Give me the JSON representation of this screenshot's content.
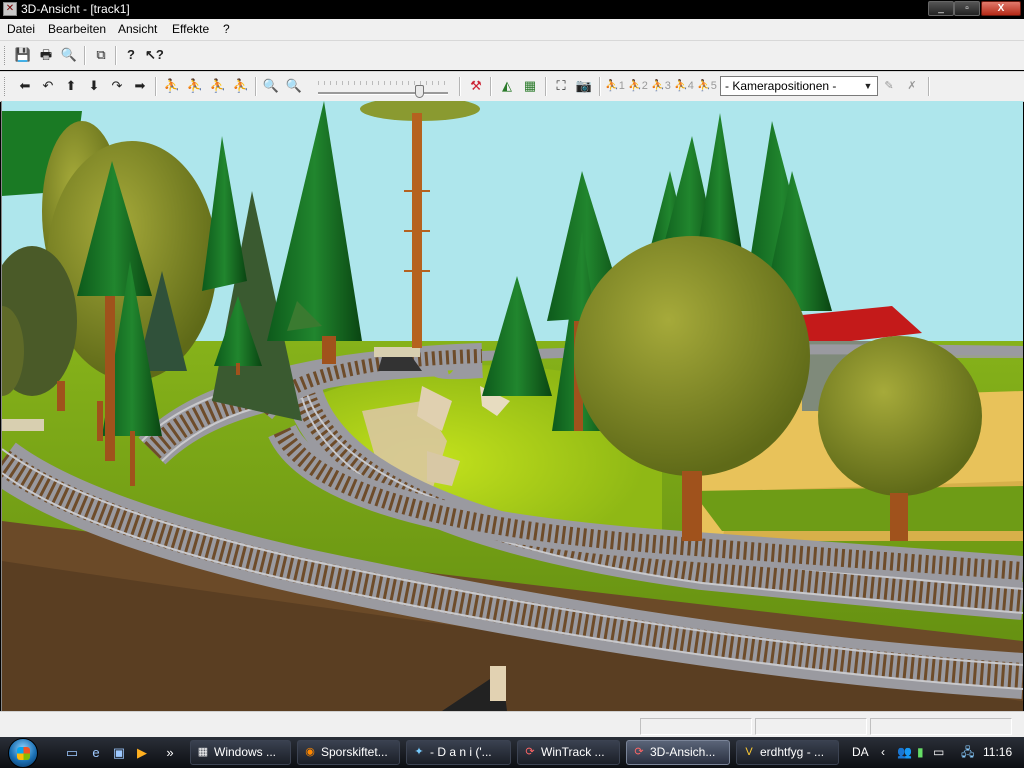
{
  "window": {
    "title": "3D-Ansicht - [track1]",
    "min": "_",
    "max": "▫",
    "close": "X"
  },
  "menu": [
    "Datei",
    "Bearbeiten",
    "Ansicht",
    "Effekte",
    "?"
  ],
  "toolbar2": {
    "camera_select": "- Kamerapositionen -",
    "camera_slots": [
      "1",
      "2",
      "3",
      "4",
      "5"
    ],
    "zoom_slider_value": 0.8
  },
  "taskbar": {
    "tasks": [
      {
        "label": "Windows ...",
        "icon": "▦"
      },
      {
        "label": "Sporskiftet...",
        "icon": "◉"
      },
      {
        "label": "-  D a n i ('...",
        "icon": "✦"
      },
      {
        "label": "WinTrack ...",
        "icon": "⟳"
      },
      {
        "label": "3D-Ansich...",
        "icon": "⟳"
      },
      {
        "label": "erdhtfyg - ...",
        "icon": "V"
      }
    ],
    "chevron": "»",
    "language": "DA",
    "clock": "11:16"
  }
}
